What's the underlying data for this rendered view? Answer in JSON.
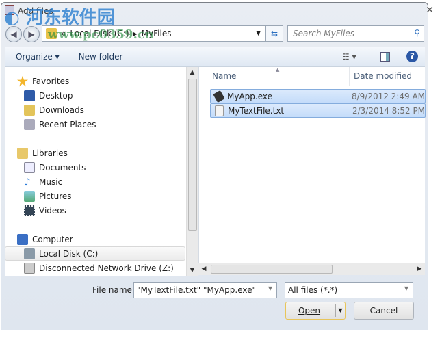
{
  "window": {
    "title": "Add files",
    "close": "✕"
  },
  "watermark": {
    "name": "河东软件园",
    "url": "www.pc0359.cn"
  },
  "address": {
    "prefix": "«",
    "crumbs": [
      "Local Disk (C:)",
      "MyFiles"
    ],
    "separator": "▸"
  },
  "search": {
    "placeholder": "Search MyFiles"
  },
  "toolbar": {
    "organize": "Organize ▾",
    "new_folder": "New folder",
    "help": "?"
  },
  "nav": {
    "favorites": "Favorites",
    "desktop": "Desktop",
    "downloads": "Downloads",
    "recent": "Recent Places",
    "libraries": "Libraries",
    "documents": "Documents",
    "music": "Music",
    "pictures": "Pictures",
    "videos": "Videos",
    "computer": "Computer",
    "local_disk": "Local Disk (C:)",
    "network": "Disconnected Network Drive (Z:)"
  },
  "columns": {
    "name": "Name",
    "date": "Date modified"
  },
  "files": [
    {
      "name": "MyApp.exe",
      "date": "8/9/2012 2:49 AM"
    },
    {
      "name": "MyTextFile.txt",
      "date": "2/3/2014 8:52 PM"
    }
  ],
  "footer": {
    "file_name_label": "File name:",
    "file_name_value": "\"MyTextFile.txt\" \"MyApp.exe\"",
    "file_type": "All files (*.*)",
    "open": "Open",
    "cancel": "Cancel"
  }
}
